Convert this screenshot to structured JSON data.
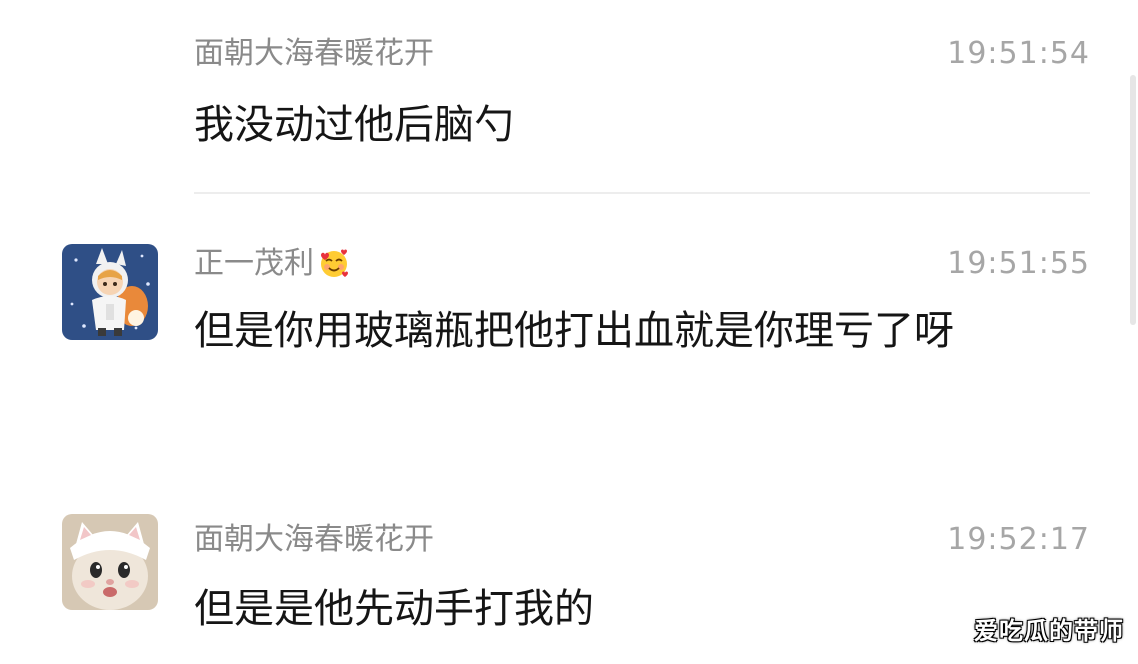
{
  "messages": [
    {
      "sender": "面朝大海春暖花开",
      "time": "19:51:54",
      "text": "我没动过他后脑勺"
    },
    {
      "sender": "正一茂利",
      "sender_emoji": "smiling-face-with-hearts-icon",
      "time": "19:51:55",
      "text": "但是你用玻璃瓶把他打出血就是你理亏了呀"
    },
    {
      "sender": "面朝大海春暖花开",
      "time": "19:52:17",
      "text": "但是是他先动手打我的"
    }
  ],
  "watermark": "爱吃瓜的带师",
  "colors": {
    "background": "#ffffff",
    "sender_name": "#8a8a8a",
    "timestamp": "#a6a6a6",
    "message_text": "#151515"
  }
}
